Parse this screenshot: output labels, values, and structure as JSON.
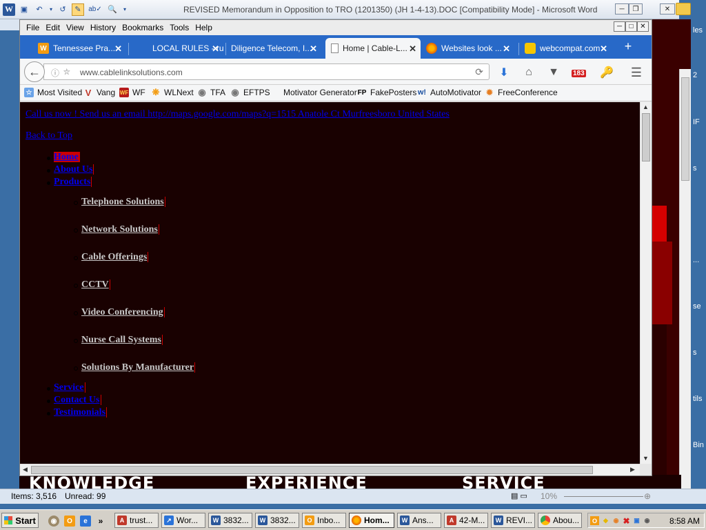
{
  "word": {
    "title": "REVISED Memorandum in Opposition to TRO (1201350) (JH 1-4-13).DOC [Compatibility Mode]  -  Microsoft Word",
    "status_items": "Items: 3,516",
    "status_unread": "Unread: 99",
    "zoom": "10%",
    "bg_words": [
      "KNOWLEDGE",
      "EXPERIENCE",
      "SERVICE"
    ],
    "desktop_side_text": [
      "les",
      "2",
      "IF",
      "s",
      "...",
      "se",
      "s",
      "tils",
      "Bin"
    ]
  },
  "browser": {
    "menu": [
      "File",
      "Edit",
      "View",
      "History",
      "Bookmarks",
      "Tools",
      "Help"
    ],
    "tabs": [
      {
        "label": "Tennessee Pra..."
      },
      {
        "label": "LOCAL RULES - rule..."
      },
      {
        "label": "Diligence Telecom, I..."
      },
      {
        "label": "Home | Cable-L..."
      },
      {
        "label": "Websites look ..."
      },
      {
        "label": "webcompat.com"
      }
    ],
    "url": "www.cablelinksolutions.com",
    "badge_count": "183",
    "bookmarks": [
      "Most Visited",
      "Vang",
      "WF",
      "WLNext",
      "TFA",
      "EFTPS",
      "Motivator Generator",
      "FakePosters",
      "AutoMotivator",
      "FreeConference"
    ]
  },
  "page": {
    "top_link": "Call us now ! Send us an email http://maps.google.com/maps?q=1515 Anatole Ct Murfreesboro United States",
    "back_to_top": "Back to Top",
    "nav": {
      "home": "Home",
      "about": "About Us",
      "products": "Products",
      "products_sub": [
        "Telephone Solutions",
        "Network Solutions",
        "Cable Offerings",
        "CCTV",
        "Video Conferencing",
        "Nurse Call Systems",
        "Solutions By Manufacturer"
      ],
      "service": "Service",
      "contact": "Contact Us",
      "testimonials": "Testimonials"
    }
  },
  "taskbar": {
    "start": "Start",
    "tasks": [
      "trust...",
      "Wor...",
      "3832...",
      "3832...",
      "Inbo...",
      "Hom...",
      "Ans...",
      "42-M...",
      "REVI...",
      "Abou..."
    ],
    "clock": "8:58 AM"
  }
}
